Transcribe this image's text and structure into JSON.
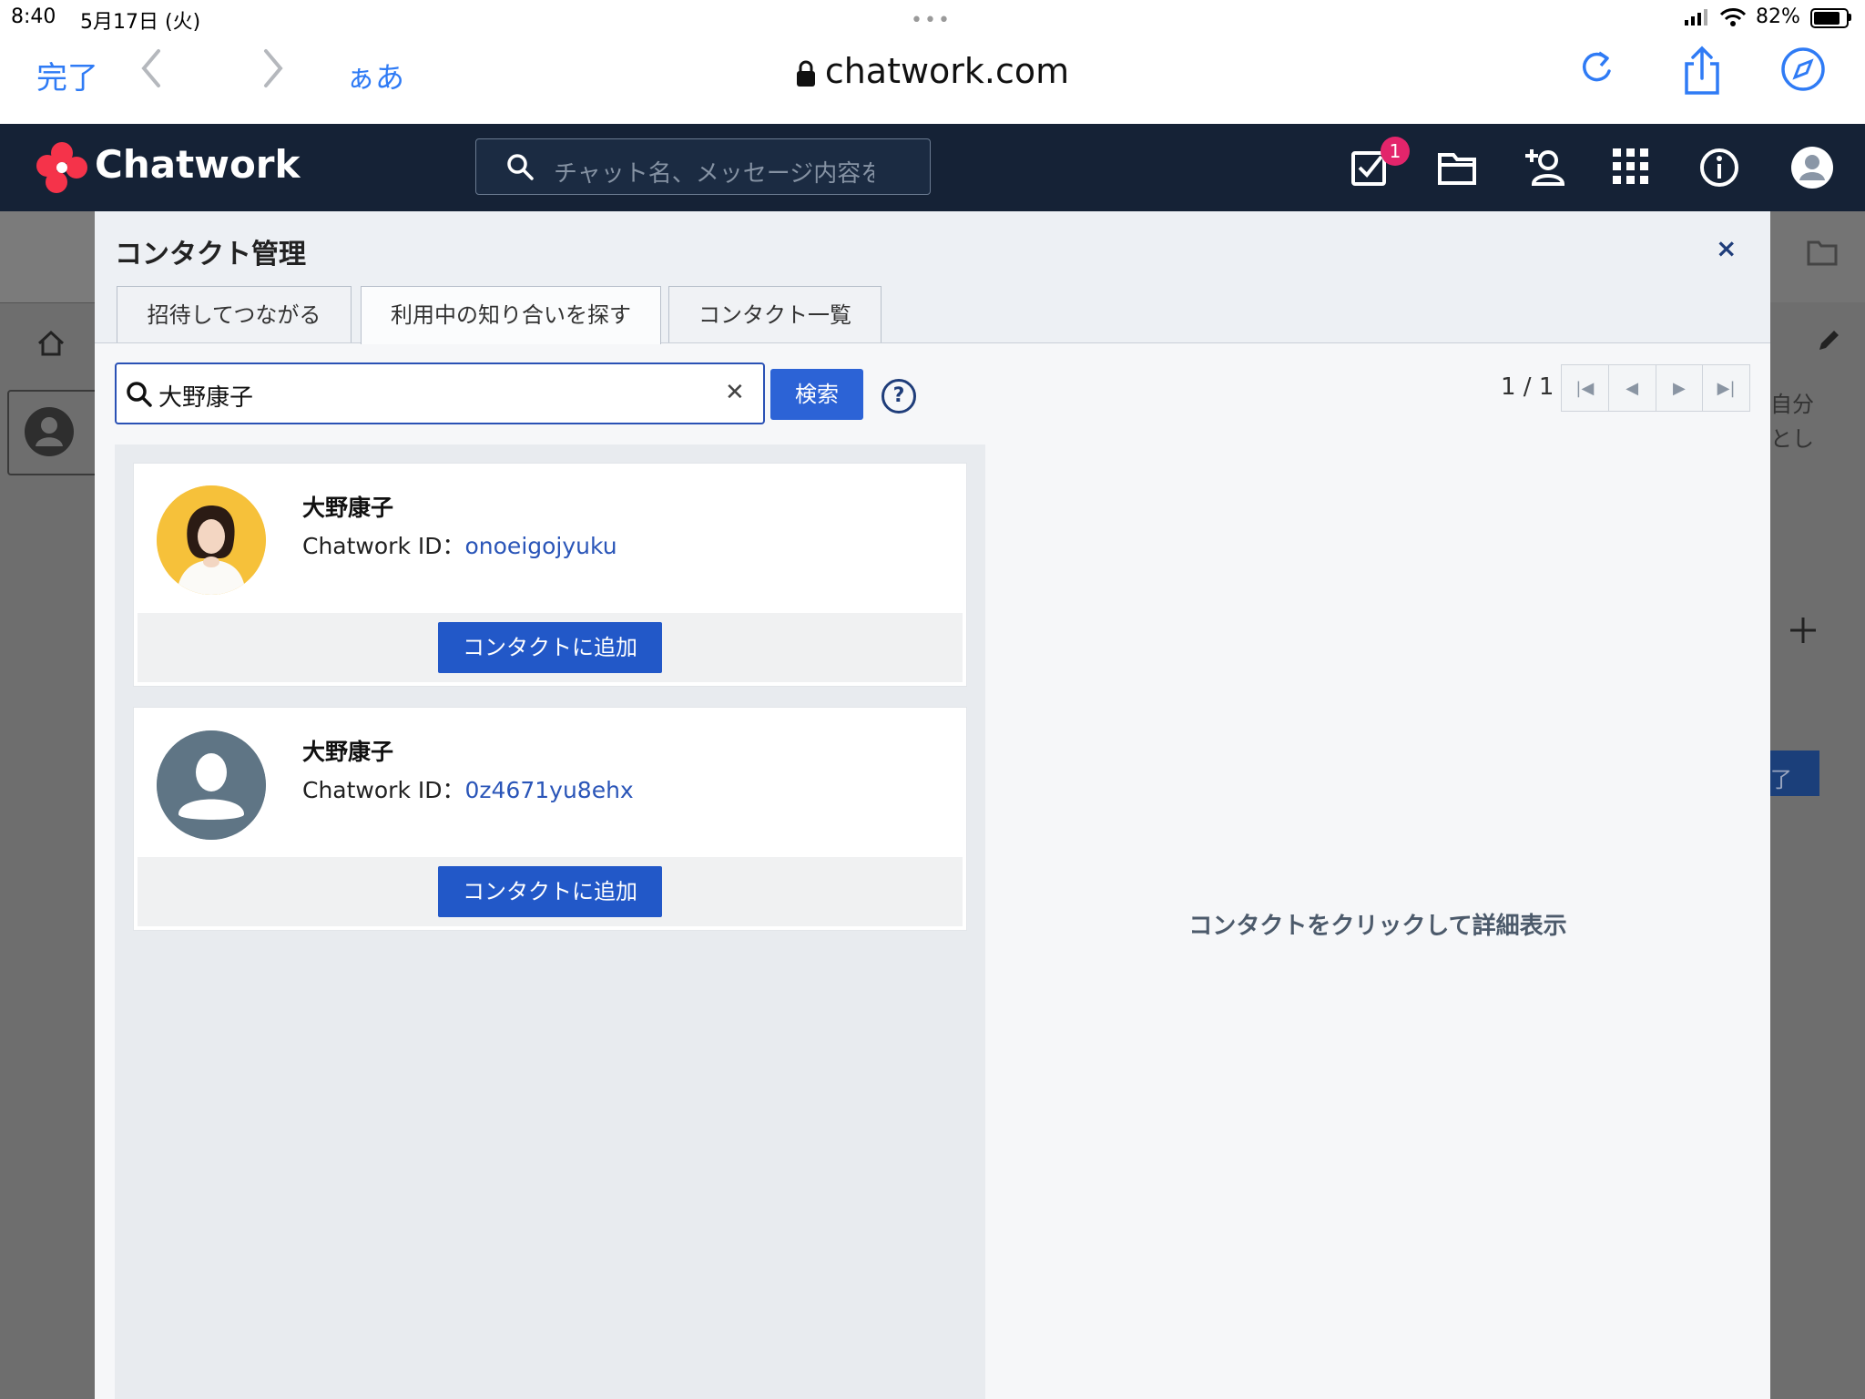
{
  "status_bar": {
    "time": "8:40",
    "date": "5月17日 (火)",
    "dots": "•••",
    "battery": "82%"
  },
  "safari": {
    "done": "完了",
    "aa": "ぁあ",
    "url": "chatwork.com"
  },
  "header": {
    "logo": "Chatwork",
    "search_placeholder": "チャット名、メッセージ内容を",
    "task_badge": "1"
  },
  "background": {
    "text_1": "自分",
    "text_2": "とし",
    "button_fragment": "了"
  },
  "modal": {
    "title": "コンタクト管理",
    "close": "×",
    "tabs": [
      {
        "label": "招待してつながる"
      },
      {
        "label": "利用中の知り合いを探す"
      },
      {
        "label": "コンタクト一覧"
      }
    ],
    "search_value": "大野康子",
    "clear": "✕",
    "search_button": "検索",
    "help": "?",
    "pager": "1 / 1",
    "results": [
      {
        "name": "大野康子",
        "id_label": "Chatwork ID：",
        "id": "onoeigojyuku",
        "add_button": "コンタクトに追加"
      },
      {
        "name": "大野康子",
        "id_label": "Chatwork ID：",
        "id": "0z4671yu8ehx",
        "add_button": "コンタクトに追加"
      }
    ],
    "detail_hint": "コンタクトをクリックして詳細表示"
  },
  "colors": {
    "header_bg": "#152236",
    "accent_blue": "#2258c8",
    "badge": "#e3256b",
    "safari_blue": "#2f7bf5"
  }
}
